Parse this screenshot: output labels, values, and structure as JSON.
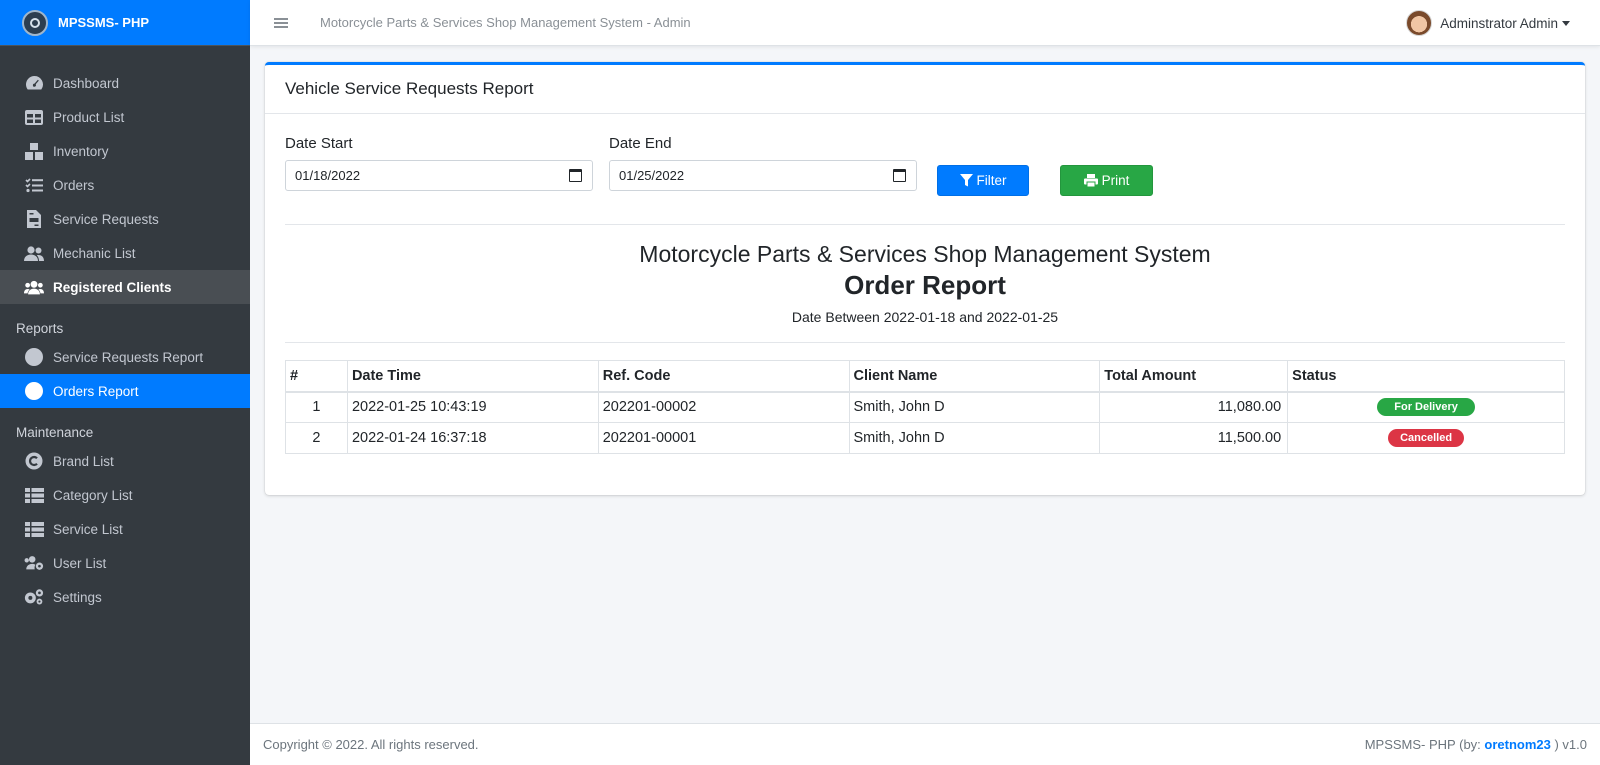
{
  "brand": {
    "name": "MPSSMS- PHP"
  },
  "topbar": {
    "title": "Motorcycle Parts & Services Shop Management System - Admin",
    "user": "Adminstrator Admin"
  },
  "sidebar": {
    "items": [
      {
        "label": "Dashboard",
        "icon": "dashboard-icon"
      },
      {
        "label": "Product List",
        "icon": "table-icon"
      },
      {
        "label": "Inventory",
        "icon": "boxes-icon"
      },
      {
        "label": "Orders",
        "icon": "tasks-icon"
      },
      {
        "label": "Service Requests",
        "icon": "file-invoice-icon"
      },
      {
        "label": "Mechanic List",
        "icon": "users-icon"
      },
      {
        "label": "Registered Clients",
        "icon": "user-friends-icon"
      }
    ],
    "reports_header": "Reports",
    "reports": [
      {
        "label": "Service Requests Report"
      },
      {
        "label": "Orders Report"
      }
    ],
    "maintenance_header": "Maintenance",
    "maintenance": [
      {
        "label": "Brand List",
        "icon": "copyright-icon"
      },
      {
        "label": "Category List",
        "icon": "list-icon"
      },
      {
        "label": "Service List",
        "icon": "list-icon"
      },
      {
        "label": "User List",
        "icon": "users-cog-icon"
      },
      {
        "label": "Settings",
        "icon": "cogs-icon"
      }
    ]
  },
  "card": {
    "title": "Vehicle Service Requests Report",
    "date_start_label": "Date Start",
    "date_start_value": "01/18/2022",
    "date_end_label": "Date End",
    "date_end_value": "01/25/2022",
    "filter_label": "Filter",
    "print_label": "Print"
  },
  "report": {
    "system": "Motorcycle Parts & Services Shop Management System",
    "title": "Order Report",
    "range": "Date Between 2022-01-18 and 2022-01-25"
  },
  "table": {
    "headers": [
      "#",
      "Date Time",
      "Ref. Code",
      "Client Name",
      "Total Amount",
      "Status"
    ],
    "rows": [
      {
        "num": "1",
        "datetime": "2022-01-25 10:43:19",
        "ref": "202201-00002",
        "client": "Smith, John D",
        "amount": "11,080.00",
        "status": "For Delivery"
      },
      {
        "num": "2",
        "datetime": "2022-01-24 16:37:18",
        "ref": "202201-00001",
        "client": "Smith, John D",
        "amount": "11,500.00",
        "status": "Cancelled"
      }
    ]
  },
  "footer": {
    "copyright": "Copyright © 2022. All rights reserved.",
    "credit_prefix": "MPSSMS- PHP (by: ",
    "credit_author": "oretnom23",
    "credit_suffix": " ) v1.0"
  },
  "colors": {
    "primary": "#007bff",
    "success": "#28a745",
    "danger": "#dc3545",
    "sidebar": "#343a40"
  }
}
